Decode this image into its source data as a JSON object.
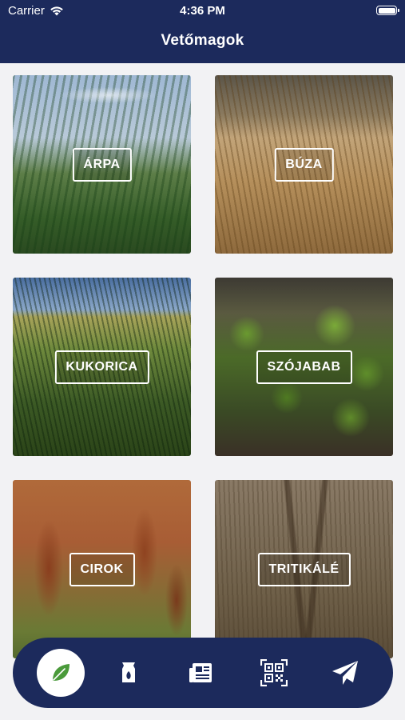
{
  "status_bar": {
    "carrier": "Carrier",
    "time": "4:36 PM",
    "wifi_icon": "wifi-icon",
    "battery_icon": "battery-icon"
  },
  "nav": {
    "title": "Vetőmagok"
  },
  "categories": [
    {
      "label": "ÁRPA"
    },
    {
      "label": "BÚZA"
    },
    {
      "label": "KUKORICA"
    },
    {
      "label": "SZÓJABAB"
    },
    {
      "label": "CIROK"
    },
    {
      "label": "TRITIKÁLÉ"
    }
  ],
  "tabbar": {
    "active_color": "#4a9a3a",
    "bar_color": "#1c2a5c",
    "tabs": [
      {
        "icon": "leaf-icon",
        "active": true
      },
      {
        "icon": "seed-bag-icon",
        "active": false
      },
      {
        "icon": "newspaper-icon",
        "active": false
      },
      {
        "icon": "qr-code-icon",
        "active": false
      },
      {
        "icon": "paper-plane-icon",
        "active": false
      }
    ]
  }
}
